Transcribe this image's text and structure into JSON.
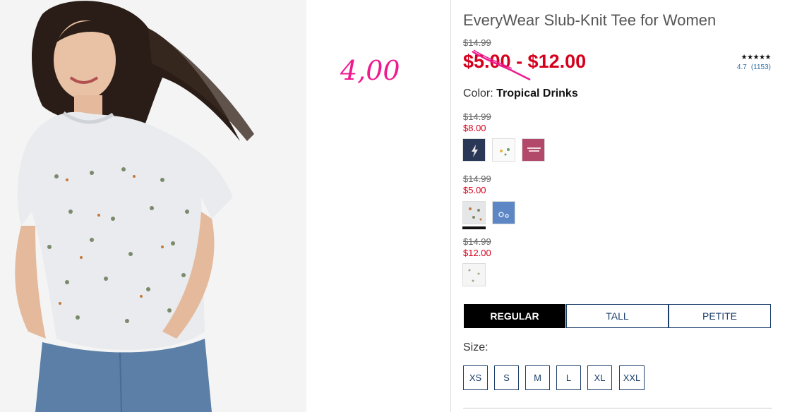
{
  "annotation": {
    "handwritten_price": "4,00"
  },
  "product": {
    "title": "EveryWear Slub-Knit Tee for Women",
    "original_price": "$14.99",
    "price_range": "$5.00 - $12.00",
    "rating": {
      "stars": "★★★★★",
      "value": "4.7",
      "count": "(1153)"
    },
    "color_label": "Color: ",
    "color_value": "Tropical Drinks"
  },
  "swatch_groups": [
    {
      "original": "$14.99",
      "sale": "$8.00",
      "swatches": [
        "navy-lightning",
        "white-pineapple",
        "berry-text"
      ]
    },
    {
      "original": "$14.99",
      "sale": "$5.00",
      "swatches": [
        "white-tropical-drinks",
        "blue-pattern"
      ],
      "selected": "white-tropical-drinks"
    },
    {
      "original": "$14.99",
      "sale": "$12.00",
      "swatches": [
        "white-floral"
      ]
    }
  ],
  "fits": [
    {
      "label": "REGULAR",
      "active": true
    },
    {
      "label": "TALL",
      "active": false
    },
    {
      "label": "PETITE",
      "active": false
    }
  ],
  "size_label": "Size:",
  "sizes": [
    "XS",
    "S",
    "M",
    "L",
    "XL",
    "XXL"
  ],
  "colors": {
    "sale_red": "#d5001c",
    "navy": "#1d3f6b",
    "annotation_pink": "#ee1a8e"
  }
}
